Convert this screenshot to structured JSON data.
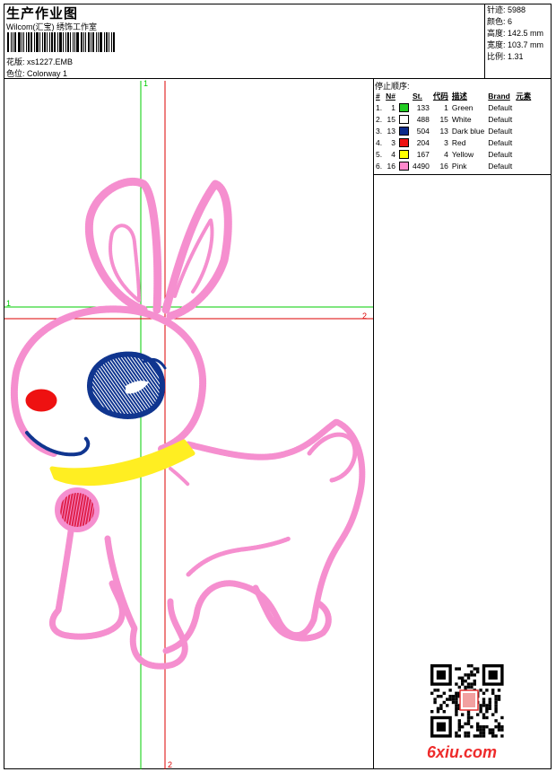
{
  "header": {
    "title": "生产作业图",
    "company": "Wilcom(汇宝) 绣饰工作室",
    "design_label": "花版:",
    "design_value": "xs1227.EMB",
    "colorway_label": "色位:",
    "colorway_value": "Colorway 1"
  },
  "stats": {
    "stitches_label": "针迹:",
    "stitches": "5988",
    "colors_label": "颜色:",
    "colors": "6",
    "height_label": "高度:",
    "height": "142.5 mm",
    "width_label": "宽度:",
    "width": "103.7 mm",
    "scale_label": "比例:",
    "scale": "1.31"
  },
  "stop_sequence": {
    "title": "停止顺序:",
    "headers": [
      "#",
      "N#",
      "",
      "St.",
      "代码",
      "描述",
      "Brand",
      "元素"
    ],
    "rows": [
      {
        "idx": "1.",
        "n": "1",
        "color": "#22cc22",
        "st": "133",
        "code": "1",
        "desc": "Green",
        "brand": "Default"
      },
      {
        "idx": "2.",
        "n": "15",
        "color": "#ffffff",
        "st": "488",
        "code": "15",
        "desc": "White",
        "brand": "Default"
      },
      {
        "idx": "3.",
        "n": "13",
        "color": "#0b2a8a",
        "st": "504",
        "code": "13",
        "desc": "Dark blue",
        "brand": "Default"
      },
      {
        "idx": "4.",
        "n": "3",
        "color": "#ee1111",
        "st": "204",
        "code": "3",
        "desc": "Red",
        "brand": "Default"
      },
      {
        "idx": "5.",
        "n": "4",
        "color": "#ffff00",
        "st": "167",
        "code": "4",
        "desc": "Yellow",
        "brand": "Default"
      },
      {
        "idx": "6.",
        "n": "16",
        "color": "#ff88cc",
        "st": "4490",
        "code": "16",
        "desc": "Pink",
        "brand": "Default"
      }
    ]
  },
  "guides": {
    "green_label_top": "1",
    "green_label_left": "1",
    "red_label_right": "2",
    "red_label_bottom": "2"
  },
  "colors": {
    "guide_green": "#00cc00",
    "guide_red": "#dd0000",
    "pink": "#f58fcf",
    "blue": "#10358f",
    "red": "#ee1111",
    "yellow": "#ffee22"
  },
  "watermark": "6xiu.com"
}
